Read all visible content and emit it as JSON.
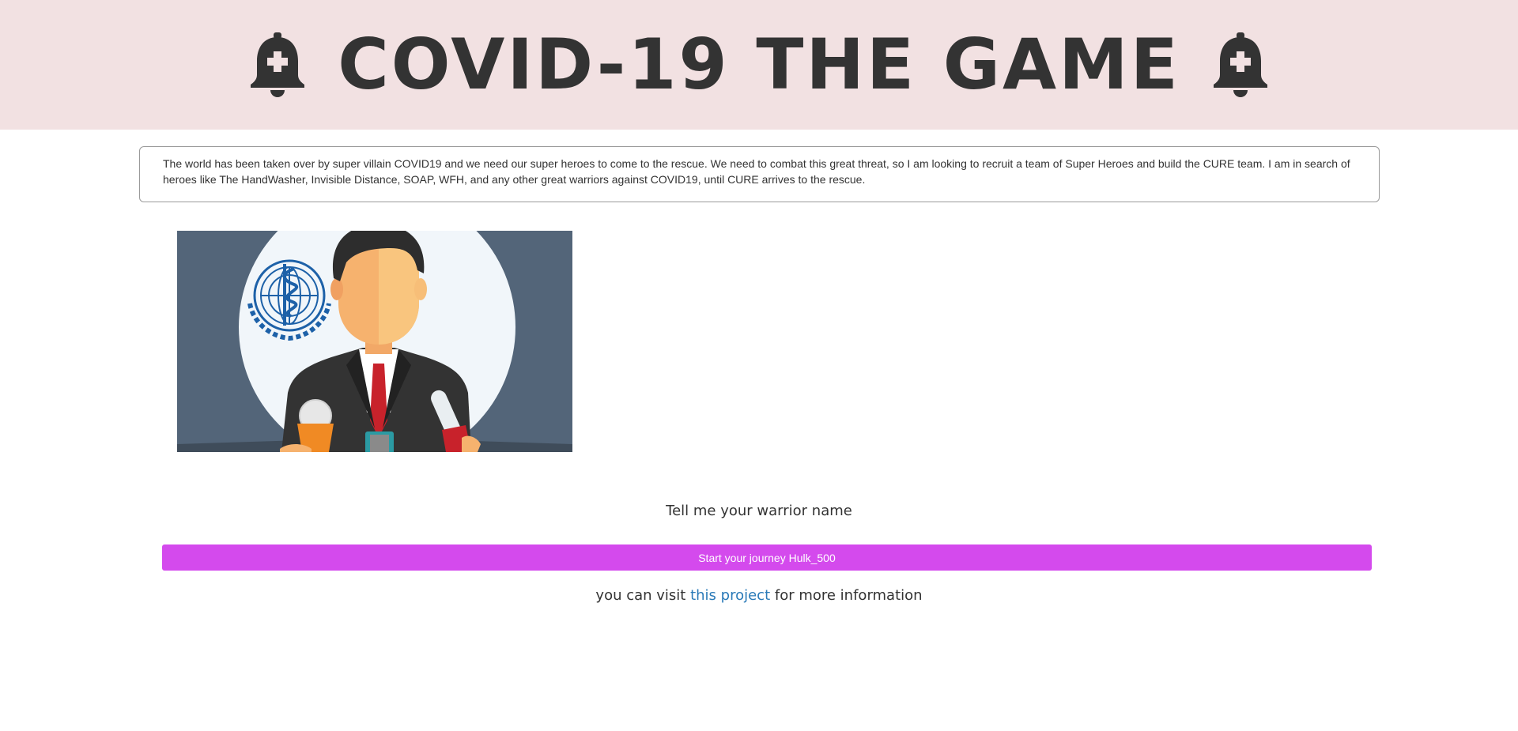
{
  "header": {
    "title": "COVID-19 THE GAME",
    "left_icon": "bell-plus-icon",
    "right_icon": "bell-plus-icon",
    "background_color": "#f2e1e2"
  },
  "intro": {
    "text": "The world has been taken over by super villain COVID19 and we need our super heroes to come to the rescue. We need to combat this great threat, so I am looking to recruit a team of Super Heroes and build the CURE team. I am in search of heroes like The HandWasher, Invisible Distance, SOAP, WFH, and any other great warriors against COVID19, until CURE arrives to the rescue."
  },
  "hero_image": {
    "subject": "press-conference-speaker-illustration"
  },
  "prompt": {
    "text": "Tell me your warrior name"
  },
  "start_button": {
    "label": "Start your journey Hulk_500",
    "color": "#d44aed"
  },
  "footer": {
    "prefix": "you can visit ",
    "link_text": "this project",
    "suffix": " for more information",
    "link_color": "#2a7ab8"
  }
}
